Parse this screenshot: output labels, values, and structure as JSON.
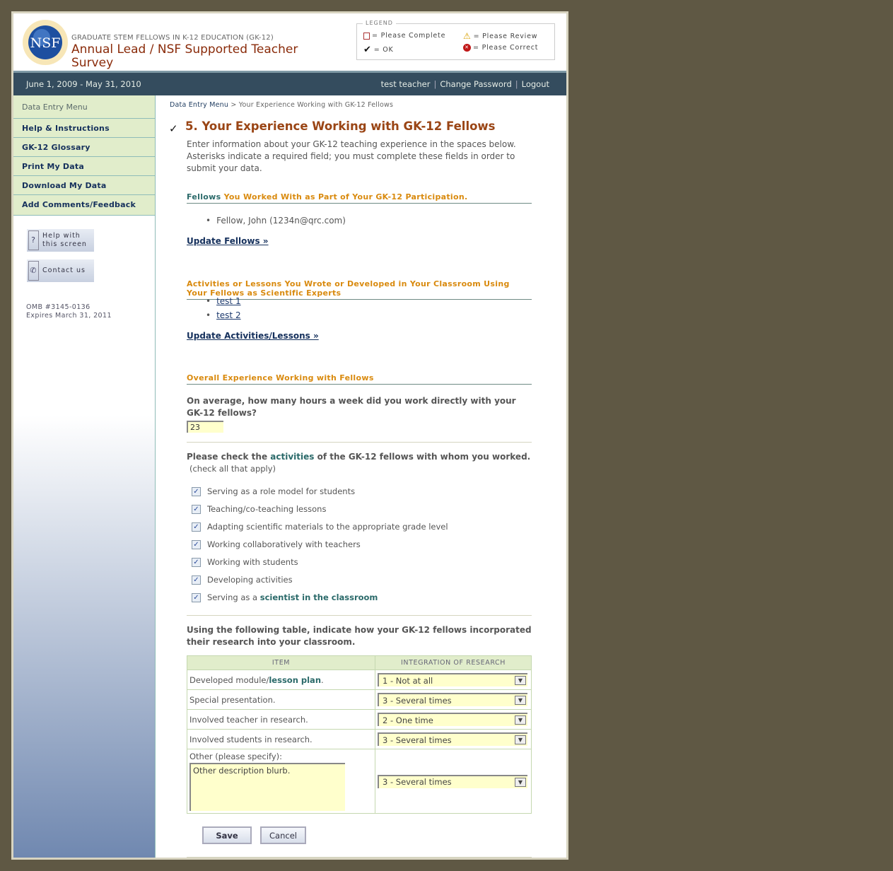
{
  "header": {
    "subtitle": "GRADUATE STEM FELLOWS IN K-12 EDUCATION (GK-12)",
    "title": "Annual Lead / NSF Supported Teacher Survey",
    "logo_text": "NSF"
  },
  "legend": {
    "title": "LEGEND",
    "complete": "= Please Complete",
    "ok": "= OK",
    "review": "= Please Review",
    "correct": "= Please Correct"
  },
  "topbar": {
    "dates": "June 1, 2009 - May 31, 2010",
    "user": "test teacher",
    "change_password": "Change Password",
    "logout": "Logout",
    "sep": "|"
  },
  "sidebar": {
    "heading": "Data Entry Menu",
    "items": [
      "Help & Instructions",
      "GK-12 Glossary",
      "Print My Data",
      "Download My Data",
      "Add Comments/Feedback"
    ],
    "help_btn": "Help with this screen",
    "contact_btn": "Contact us",
    "omb": "OMB #3145-0136",
    "expires": "Expires March 31, 2011"
  },
  "breadcrumb": {
    "root": "Data Entry Menu",
    "sep": ">",
    "current": "Your Experience Working with GK-12 Fellows"
  },
  "main": {
    "check": "✓",
    "title": "5. Your Experience Working with GK-12 Fellows",
    "intro": "Enter information about your GK-12 teaching experience in the spaces below. Asterisks indicate a required field; you must complete these fields in order to submit your data.",
    "sec1_a": "Fellows",
    "sec1_b": " You Worked With as Part of Your GK-12 Participation.",
    "fellows": [
      "Fellow, John (1234n@qrc.com)"
    ],
    "update_fellows": "Update Fellows »",
    "sec2": "Activities or Lessons You Wrote or Developed in Your Classroom Using Your Fellows as Scientific Experts",
    "lessons": [
      "test 1",
      "test 2"
    ],
    "update_lessons": "Update Activities/Lessons »",
    "sec3": "Overall Experience Working with Fellows",
    "q_hours": "On average, how many hours a week did you work directly with your GK-12 fellows?",
    "hours": "23",
    "q_act_a": "Please check the ",
    "q_act_b": "activities",
    "q_act_c": " of the GK-12 fellows with whom you worked.",
    "q_act_hint": "(check all that apply)",
    "activities": [
      "Serving as a role model for students",
      "Teaching/co-teaching lessons",
      "Adapting scientific materials to the appropriate grade level",
      "Working collaboratively with teachers",
      "Working with students",
      "Developing activities",
      "Serving as a "
    ],
    "activity_last_bold": "scientist in the classroom",
    "q_table": "Using the following table, indicate how your GK-12 fellows incorporated their research into your classroom.",
    "table": {
      "col_item": "ITEM",
      "col_int": "INTEGRATION OF RESEARCH",
      "row1_a": "Developed module/",
      "row1_b": "lesson plan",
      "row1_c": ".",
      "rows": [
        "Special presentation.",
        "Involved teacher in research.",
        "Involved students in research."
      ],
      "values": [
        "1 - Not at all",
        "3 - Several times",
        "2 - One time",
        "3 - Several times",
        "3 - Several times"
      ],
      "other_label": "Other (please specify):",
      "other_text": "Other description blurb."
    },
    "save": "Save",
    "cancel": "Cancel"
  }
}
